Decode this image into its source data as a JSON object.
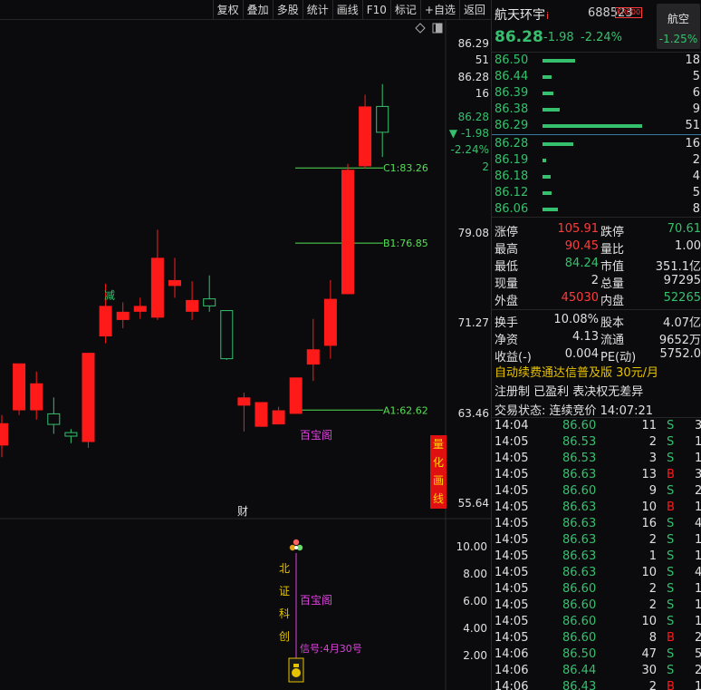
{
  "toolbar": {
    "buttons": [
      "复权",
      "叠加",
      "多股",
      "统计",
      "画线",
      "F10",
      "标记",
      "+自选",
      "返回"
    ]
  },
  "stock": {
    "name": "航天环宇",
    "name_mark": "i",
    "code": "688523",
    "badge": "KR000",
    "price": "86.28",
    "change": "-1.98",
    "change_pct": "-2.24%",
    "sector": "航空",
    "sector_pct": "-1.25%"
  },
  "price_axis": {
    "labels": [
      "86.29",
      "51",
      "86.28",
      "16",
      "86.28",
      "▼ -1.98",
      "-2.24%",
      "2",
      "79.08",
      "71.27",
      "63.46",
      "55.64"
    ],
    "indicator_labels": [
      "10.00",
      "8.00",
      "6.00",
      "4.00",
      "2.00"
    ]
  },
  "chart_data": {
    "type": "candlestick",
    "candles": [
      {
        "o": 59.6,
        "c": 61.5,
        "h": 62.2,
        "l": 58.6
      },
      {
        "o": 62.6,
        "c": 66.6,
        "h": 66.6,
        "l": 62.2
      },
      {
        "o": 62.6,
        "c": 64.9,
        "h": 65.9,
        "l": 61.8
      },
      {
        "o": 62.3,
        "c": 61.4,
        "h": 63.7,
        "l": 60.6
      },
      {
        "o": 60.7,
        "c": 60.4,
        "h": 61.0,
        "l": 59.8
      },
      {
        "o": 59.9,
        "c": 67.5,
        "h": 67.5,
        "l": 59.4
      },
      {
        "o": 68.9,
        "c": 71.5,
        "h": 73.4,
        "l": 68.3
      },
      {
        "o": 70.3,
        "c": 71.0,
        "h": 71.8,
        "l": 69.6
      },
      {
        "o": 71.0,
        "c": 71.5,
        "h": 72.2,
        "l": 70.4
      },
      {
        "o": 70.5,
        "c": 75.6,
        "h": 78.0,
        "l": 70.3
      },
      {
        "o": 73.2,
        "c": 73.7,
        "h": 75.6,
        "l": 72.2
      },
      {
        "o": 71.0,
        "c": 72.0,
        "h": 73.6,
        "l": 70.3
      },
      {
        "o": 72.1,
        "c": 71.5,
        "h": 74.1,
        "l": 71.0
      },
      {
        "o": 71.1,
        "c": 67.0,
        "h": 71.1,
        "l": 66.9
      },
      {
        "o": 63.0,
        "c": 63.7,
        "h": 64.1,
        "l": 60.8
      },
      {
        "o": 61.2,
        "c": 63.3,
        "h": 63.3,
        "l": 61.2
      },
      {
        "o": 61.4,
        "c": 62.6,
        "h": 62.9,
        "l": 61.5
      },
      {
        "o": 62.3,
        "c": 65.4,
        "h": 65.4,
        "l": 62.3
      },
      {
        "o": 66.5,
        "c": 67.8,
        "h": 70.4,
        "l": 65.1
      },
      {
        "o": 68.1,
        "c": 72.1,
        "h": 73.7,
        "l": 67.0
      },
      {
        "o": 72.5,
        "c": 83.1,
        "h": 83.6,
        "l": 72.5
      },
      {
        "o": 83.4,
        "c": 88.5,
        "h": 89.5,
        "l": 83.2
      },
      {
        "o": 88.5,
        "c": 86.3,
        "h": 90.4,
        "l": 84.2
      }
    ],
    "ylim": [
      53.6,
      93.4
    ],
    "levels": [
      {
        "label": "C1:83.26",
        "value": 83.26
      },
      {
        "label": "B1:76.85",
        "value": 76.85
      },
      {
        "label": "A1:62.62",
        "value": 62.62
      }
    ],
    "annotations": {
      "down_label": "减",
      "pattern_label": "百宝阁",
      "finance_label": "财"
    },
    "quant_label": [
      "量",
      "化",
      "画",
      "线"
    ]
  },
  "indicator": {
    "chars": [
      "北",
      "证",
      "科",
      "创"
    ],
    "label": "百宝阁",
    "signal": "信号:4月30号"
  },
  "orderbook": [
    {
      "price": "86.50",
      "vol": "18",
      "bar": 0.33
    },
    {
      "price": "86.44",
      "vol": "5",
      "bar": 0.09
    },
    {
      "price": "86.39",
      "vol": "6",
      "bar": 0.11
    },
    {
      "price": "86.38",
      "vol": "9",
      "bar": 0.17
    },
    {
      "price": "86.29",
      "vol": "51",
      "bar": 1.0
    },
    {
      "price": "86.28",
      "vol": "16",
      "bar": 0.31
    },
    {
      "price": "86.19",
      "vol": "2",
      "bar": 0.04
    },
    {
      "price": "86.18",
      "vol": "4",
      "bar": 0.08
    },
    {
      "price": "86.12",
      "vol": "5",
      "bar": 0.09
    },
    {
      "price": "86.06",
      "vol": "8",
      "bar": 0.15
    }
  ],
  "stats": [
    [
      {
        "l": "涨停",
        "v": "105.91",
        "c": "#ff3b3b"
      },
      {
        "l": "跌停",
        "v": "70.61",
        "c": "#35c06d"
      }
    ],
    [
      {
        "l": "最高",
        "v": "90.45",
        "c": "#ff3b3b"
      },
      {
        "l": "量比",
        "v": "1.00",
        "c": "#e0e0e0"
      }
    ],
    [
      {
        "l": "最低",
        "v": "84.24",
        "c": "#35c06d"
      },
      {
        "l": "市值",
        "v": "351.1亿",
        "c": "#e0e0e0"
      }
    ],
    [
      {
        "l": "现量",
        "v": "2",
        "c": "#e0e0e0"
      },
      {
        "l": "总量",
        "v": "97295",
        "c": "#e0e0e0"
      }
    ],
    [
      {
        "l": "外盘",
        "v": "45030",
        "c": "#ff3b3b"
      },
      {
        "l": "内盘",
        "v": "52265",
        "c": "#35c06d"
      }
    ],
    "sep",
    [
      {
        "l": "换手",
        "v": "10.08%",
        "c": "#e0e0e0"
      },
      {
        "l": "股本",
        "v": "4.07亿",
        "c": "#e0e0e0"
      }
    ],
    [
      {
        "l": "净资",
        "v": "4.13",
        "c": "#e0e0e0"
      },
      {
        "l": "流通",
        "v": "9652万",
        "c": "#e0e0e0"
      }
    ],
    [
      {
        "l": "收益(-)",
        "v": "0.004",
        "c": "#e0e0e0"
      },
      {
        "l": "PE(动)",
        "v": "5752.0",
        "c": "#e0e0e0"
      }
    ]
  ],
  "subscribe": "自动续费通达信普及版  30元/月",
  "reg_info": "注册制 已盈利 表决权无差异",
  "trade_status": "交易状态: 连续竞价 14:07:21",
  "ticks": [
    {
      "t": "14:04",
      "p": "86.60",
      "v": "11",
      "s": "S",
      "x": "3"
    },
    {
      "t": "14:05",
      "p": "86.53",
      "v": "2",
      "s": "S",
      "x": "1"
    },
    {
      "t": "14:05",
      "p": "86.53",
      "v": "3",
      "s": "S",
      "x": "1"
    },
    {
      "t": "14:05",
      "p": "86.63",
      "v": "13",
      "s": "B",
      "x": "3"
    },
    {
      "t": "14:05",
      "p": "86.60",
      "v": "9",
      "s": "S",
      "x": "2"
    },
    {
      "t": "14:05",
      "p": "86.63",
      "v": "10",
      "s": "B",
      "x": "1"
    },
    {
      "t": "14:05",
      "p": "86.63",
      "v": "16",
      "s": "S",
      "x": "4"
    },
    {
      "t": "14:05",
      "p": "86.63",
      "v": "2",
      "s": "S",
      "x": "1"
    },
    {
      "t": "14:05",
      "p": "86.63",
      "v": "1",
      "s": "S",
      "x": "1"
    },
    {
      "t": "14:05",
      "p": "86.63",
      "v": "10",
      "s": "S",
      "x": "4"
    },
    {
      "t": "14:05",
      "p": "86.60",
      "v": "2",
      "s": "S",
      "x": "1"
    },
    {
      "t": "14:05",
      "p": "86.60",
      "v": "2",
      "s": "S",
      "x": "1"
    },
    {
      "t": "14:05",
      "p": "86.60",
      "v": "10",
      "s": "S",
      "x": "1"
    },
    {
      "t": "14:05",
      "p": "86.60",
      "v": "8",
      "s": "B",
      "x": "2"
    },
    {
      "t": "14:06",
      "p": "86.50",
      "v": "47",
      "s": "S",
      "x": "5"
    },
    {
      "t": "14:06",
      "p": "86.44",
      "v": "30",
      "s": "S",
      "x": "2"
    },
    {
      "t": "14:06",
      "p": "86.43",
      "v": "2",
      "s": "B",
      "x": "1"
    }
  ],
  "colors": {
    "up": "#ff1a1a",
    "down": "#35c06d",
    "level": "#55e055",
    "magenta": "#e040e0",
    "yellow": "#e6c300"
  }
}
